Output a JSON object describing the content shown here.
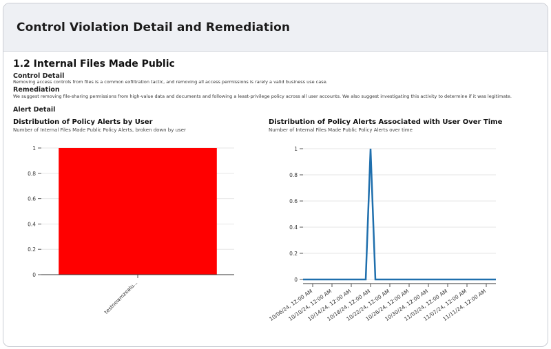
{
  "card": {
    "title": "Control Violation Detail and Remediation"
  },
  "section": {
    "title": "1.2 Internal Files Made Public",
    "control_detail_heading": "Control Detail",
    "control_detail_text": "Removing access controls from files is a common exfiltration tactic, and removing all access permissions is rarely a valid business use case.",
    "remediation_heading": "Remediation",
    "remediation_text": "We suggest removing file-sharing permissions from high-value data and documents and following a least-privilege policy across all user accounts. We also suggest investigating this activity to determine if it was legitimate.",
    "alert_detail_heading": "Alert Detail"
  },
  "colors": {
    "bar": "#ff0000",
    "line": "#1f6fad",
    "header_bg": "#eef0f4"
  },
  "chart_data": [
    {
      "type": "bar",
      "title": "Distribution of Policy Alerts by User",
      "subtitle": "Number of Internal Files Made Public Policy Alerts, broken down by user",
      "categories": [
        "testnewmzealu..."
      ],
      "values": [
        1
      ],
      "ylim": [
        0,
        1
      ],
      "yticks": [
        "0",
        "0.2",
        "0.4",
        "0.6",
        "0.8",
        "1"
      ],
      "xlabel": "",
      "ylabel": "",
      "grid": true
    },
    {
      "type": "line",
      "title": "Distribution of Policy Alerts Associated with User Over Time",
      "subtitle": "Number of Internal Files Made Public Policy Alerts over time",
      "x_tick_labels": [
        "10/06/24, 12:00 AM",
        "10/10/24, 12:00 AM",
        "10/14/24, 12:00 AM",
        "10/18/24, 12:00 AM",
        "10/22/24, 12:00 AM",
        "10/26/24, 12:00 AM",
        "10/30/24, 12:00 AM",
        "11/03/24, 12:00 AM",
        "11/07/24, 12:00 AM",
        "11/11/24, 12:00 AM"
      ],
      "yticks": [
        "0",
        "0.2",
        "0.4",
        "0.6",
        "0.8",
        "1"
      ],
      "ylim": [
        0,
        1
      ],
      "series": [
        {
          "x": [
            "10/04/24",
            "10/17/24",
            "10/18/24",
            "10/19/24",
            "11/13/24"
          ],
          "values": [
            0,
            0,
            1,
            0,
            0
          ]
        }
      ],
      "grid": true
    }
  ]
}
